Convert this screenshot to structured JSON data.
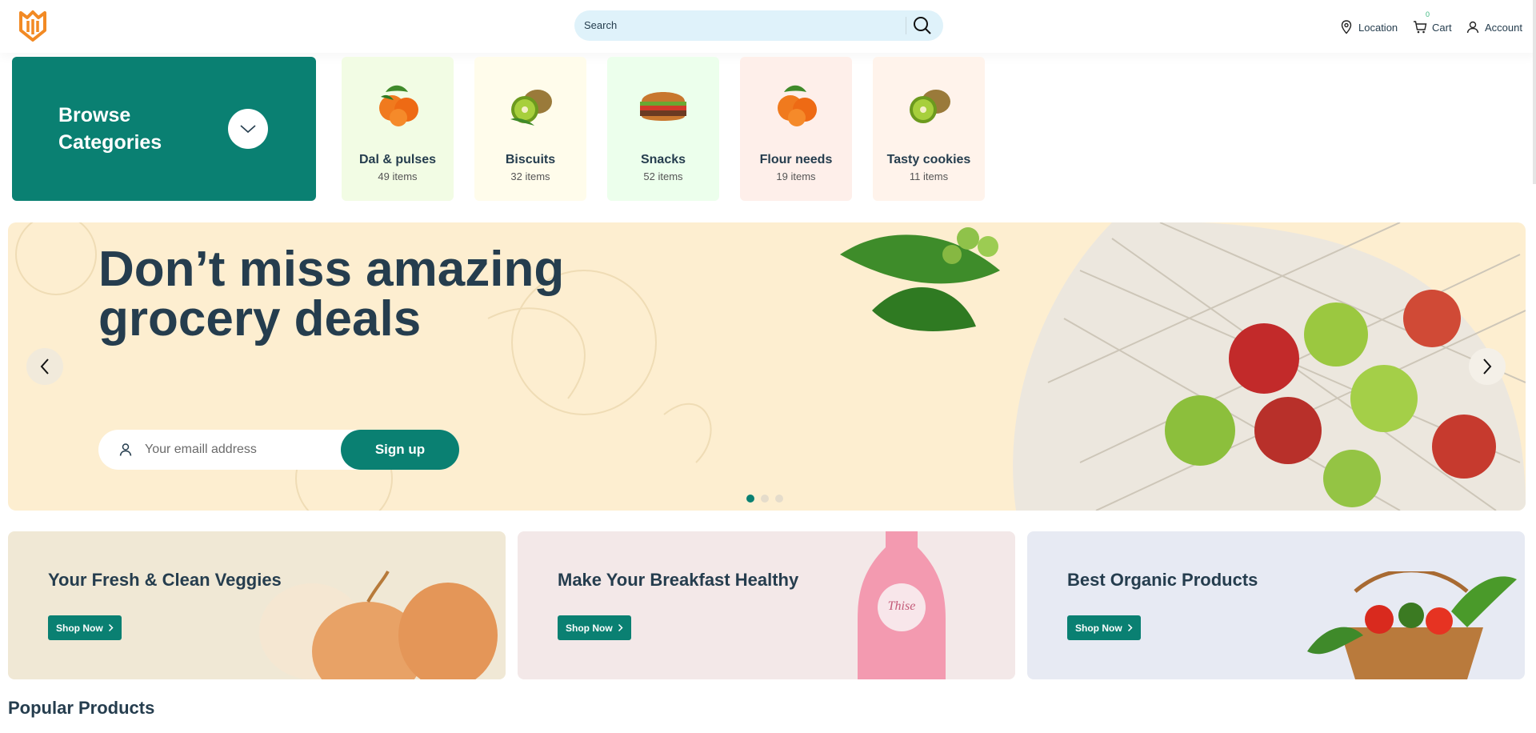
{
  "header": {
    "search_placeholder": "Search",
    "nav": {
      "location": "Location",
      "cart": "Cart",
      "cart_count": "0",
      "account": "Account"
    }
  },
  "browse": {
    "title": "Browse Categories"
  },
  "categories": [
    {
      "name": "Dal & pulses",
      "count": "49 items",
      "bg": "#f2fce4"
    },
    {
      "name": "Biscuits",
      "count": "32 items",
      "bg": "#fffceb"
    },
    {
      "name": "Snacks",
      "count": "52 items",
      "bg": "#ecffec"
    },
    {
      "name": "Flour needs",
      "count": "19 items",
      "bg": "#feefea"
    },
    {
      "name": "Tasty cookies",
      "count": "11 items",
      "bg": "#fff3eb"
    }
  ],
  "hero": {
    "title_line1": "Don’t miss amazing",
    "title_line2": "grocery deals",
    "email_placeholder": "Your emaill address",
    "signup_label": "Sign up",
    "slide_active": 1,
    "slide_count": 3
  },
  "banners": [
    {
      "title": "Your Fresh & Clean Veggies",
      "button": "Shop Now",
      "bg": "#f0e8d5"
    },
    {
      "title": "Make Your Breakfast Healthy",
      "button": "Shop Now",
      "bg": "#f3e8e8"
    },
    {
      "title": "Best Organic Products",
      "button": "Shop Now",
      "bg": "#e7eaf3"
    }
  ],
  "sections": {
    "popular": "Popular Products"
  },
  "colors": {
    "primary": "#0a8072",
    "heading": "#253d4e",
    "logo": "#f28a24"
  }
}
